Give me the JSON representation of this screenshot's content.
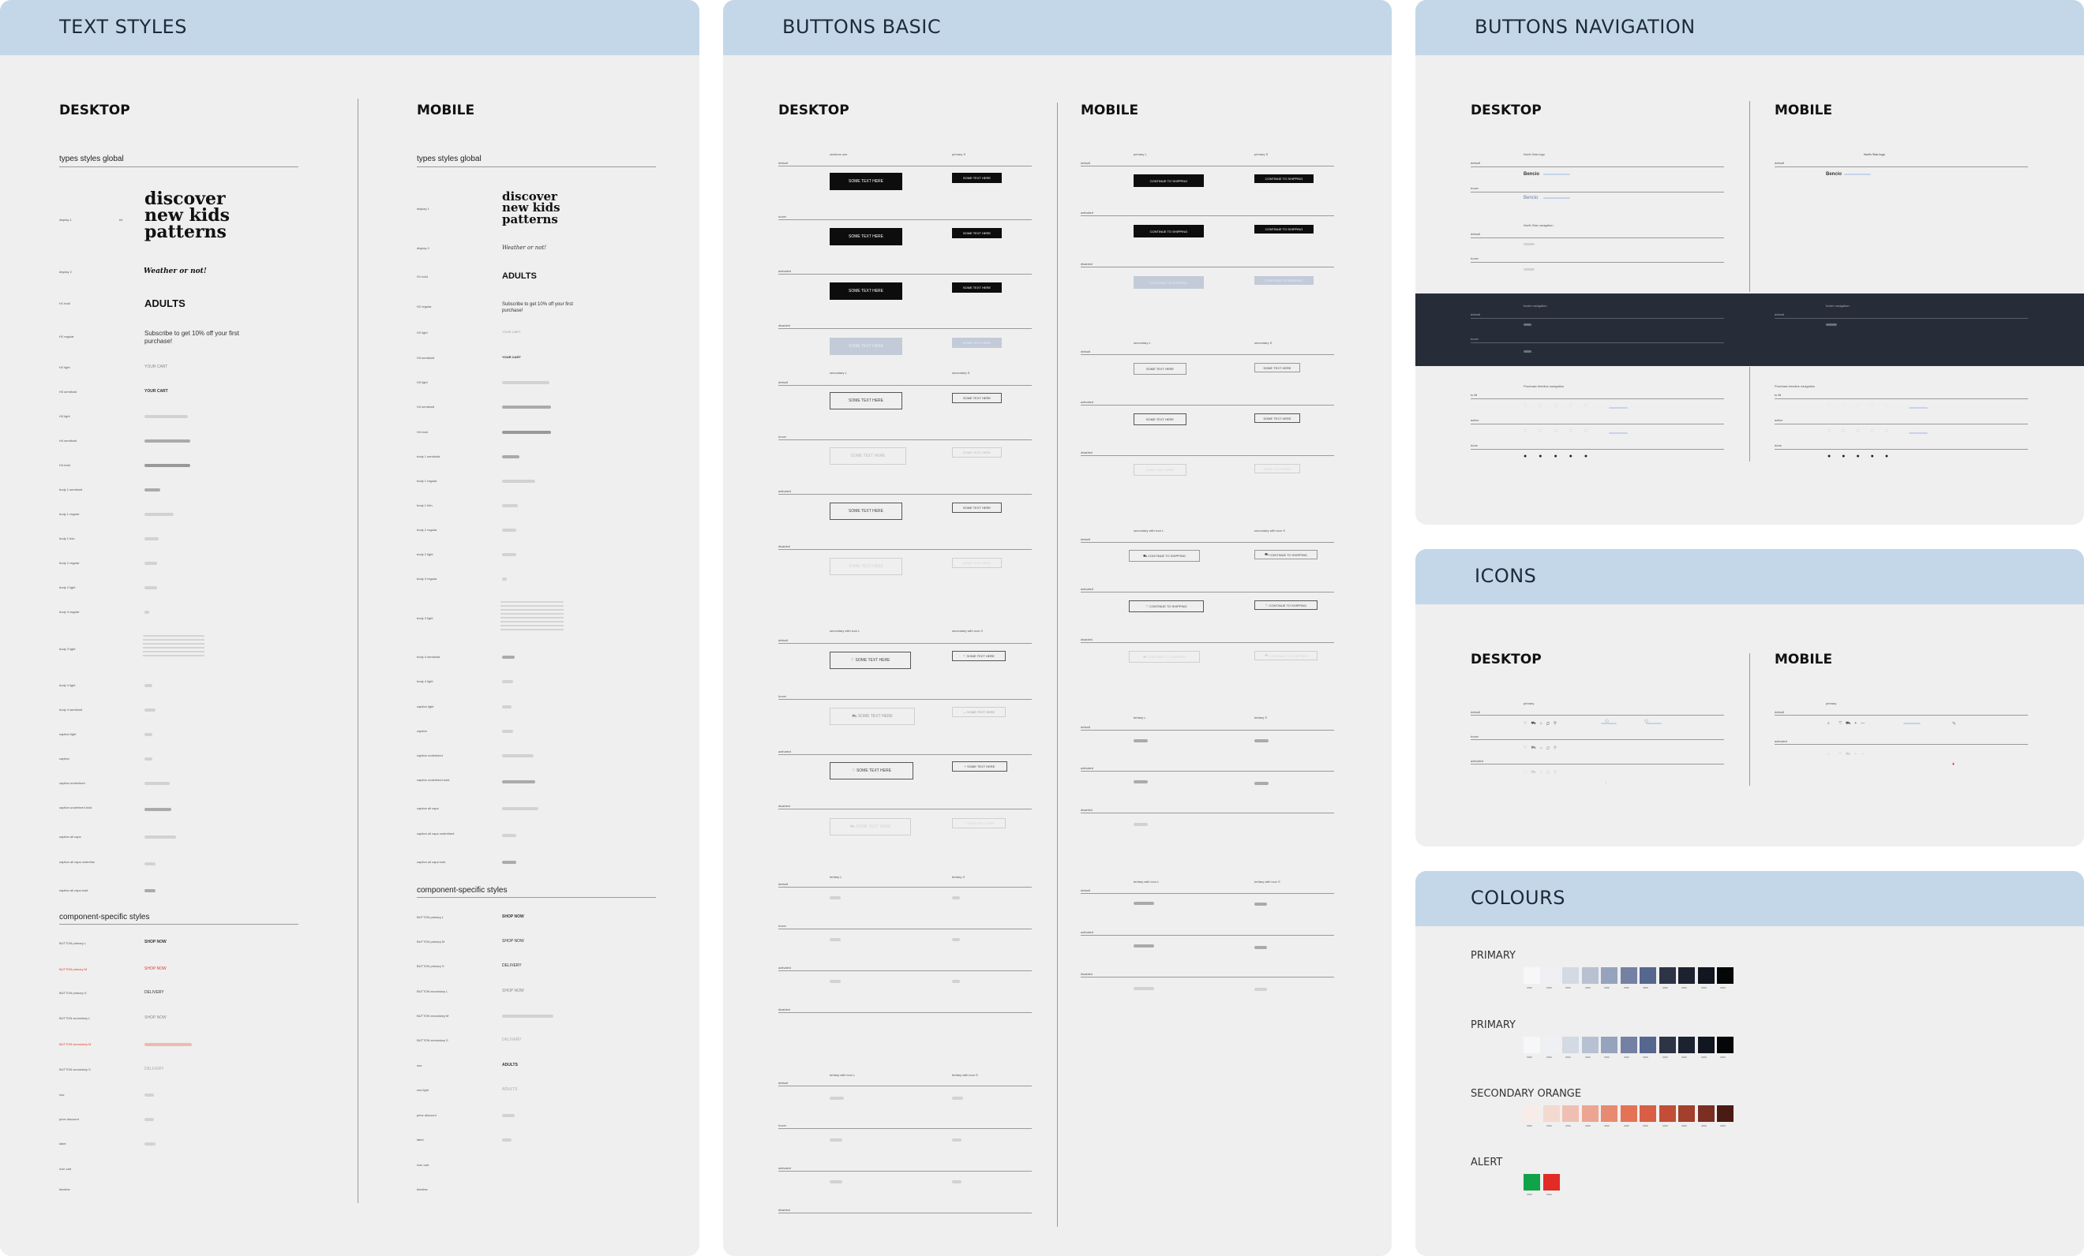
{
  "text_styles": {
    "title": "TEXT STYLES",
    "desktop": "DESKTOP",
    "mobile": "MOBILE",
    "global_heading": "types styles global",
    "component_heading": "component-specific styles",
    "display_sample": "discover new kids patterns",
    "weather": "Weather or not!",
    "adults": "ADULTS",
    "subscribe": "Subscribe to get 10% off your first purchase!",
    "your_cart": "YOUR CART",
    "shop_now": "SHOP NOW",
    "delivery": "DELIVERY"
  },
  "buttons_basic": {
    "title": "BUTTONS BASIC",
    "desktop": "DESKTOP",
    "mobile": "MOBILE",
    "btn_label": "SOME TEXT HERE",
    "continue_label": "CONTINUE TO SHIPPING"
  },
  "buttons_nav": {
    "title": "BUTTONS NAVIGATION",
    "desktop": "DESKTOP",
    "mobile": "MOBILE",
    "logo": "Bencio"
  },
  "icons": {
    "title": "ICONS",
    "desktop": "DESKTOP",
    "mobile": "MOBILE"
  },
  "colours": {
    "title": "COLOURS",
    "groups": [
      {
        "label": "PRIMARY",
        "swatches": [
          "#f7f7f9",
          "#eef0f4",
          "#d4dae4",
          "#b7c1d2",
          "#96a3bc",
          "#7481a3",
          "#55668f",
          "#2c3445",
          "#1c2230",
          "#121620",
          "#050608"
        ]
      },
      {
        "label": "PRIMARY",
        "swatches": [
          "#f7f7f9",
          "#eef0f4",
          "#d4dae4",
          "#b7c1d2",
          "#96a3bc",
          "#7481a3",
          "#55668f",
          "#2c3445",
          "#1c2230",
          "#121620",
          "#050608"
        ]
      },
      {
        "label": "SECONDARY ORANGE",
        "swatches": [
          "#f8ece8",
          "#f3d9d0",
          "#efc0b2",
          "#ec a592",
          "#e88a71",
          "#e57257",
          "#d95e45",
          "#c24e38",
          "#a23f2d",
          "#7b2f21",
          "#4a1b12"
        ]
      },
      {
        "label": "ALERT",
        "swatches": [
          "#11a349",
          "#e12b25"
        ]
      }
    ]
  }
}
